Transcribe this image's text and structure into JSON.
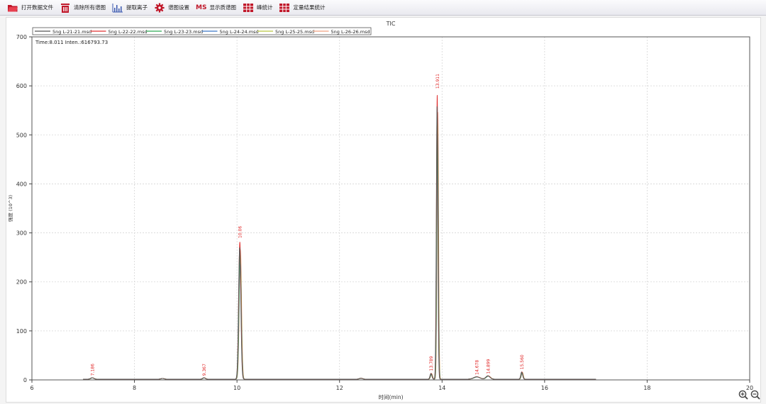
{
  "toolbar": {
    "items": [
      {
        "label": "打开数据文件",
        "icon": "open-file-icon"
      },
      {
        "label": "清除所有谱图",
        "icon": "trash-icon"
      },
      {
        "label": "提取离子",
        "icon": "spectrum-icon"
      },
      {
        "label": "谱图设置",
        "icon": "gear-icon"
      },
      {
        "label": "显示质谱图",
        "icon": "mass-spectrum-icon",
        "badge": "MS"
      },
      {
        "label": "峰统计",
        "icon": "table-icon"
      },
      {
        "label": "定量结果统计",
        "icon": "table-icon"
      }
    ]
  },
  "colors": {
    "accent": "#c0182a",
    "series": [
      "#555555",
      "#e03030",
      "#2eaa55",
      "#3a78c8",
      "#b9c840",
      "#f0a080"
    ]
  },
  "chart_data": {
    "type": "line",
    "title": "TIC",
    "xlabel": "时间(min)",
    "ylabel": "强度 (10^3)",
    "xlim": [
      6,
      20
    ],
    "ylim": [
      0,
      700
    ],
    "xticks": [
      6,
      8,
      10,
      12,
      14,
      16,
      18,
      20
    ],
    "yticks": [
      0,
      100,
      200,
      300,
      400,
      500,
      600,
      700
    ],
    "grid": true,
    "legend_position": "top",
    "readout": "Time:8.011  Inten.:616793.73",
    "x_range_plotted": [
      7.0,
      17.0
    ],
    "baseline": 1.5,
    "peaks": [
      {
        "x": 7.18,
        "height": 3,
        "width": 0.03
      },
      {
        "x": 8.55,
        "height": 1.5,
        "width": 0.03
      },
      {
        "x": 9.36,
        "height": 3,
        "width": 0.025
      },
      {
        "x": 10.06,
        "height": 280,
        "width": 0.022
      },
      {
        "x": 12.42,
        "height": 2,
        "width": 0.03
      },
      {
        "x": 13.79,
        "height": 12,
        "width": 0.018
      },
      {
        "x": 13.91,
        "height": 580,
        "width": 0.015
      },
      {
        "x": 14.68,
        "height": 5,
        "width": 0.06
      },
      {
        "x": 14.9,
        "height": 7,
        "width": 0.04
      },
      {
        "x": 15.56,
        "height": 15,
        "width": 0.018
      }
    ],
    "series": [
      {
        "name": "5ng L-21-21.msd",
        "scale": 0.96
      },
      {
        "name": "5ng L-22-22.msd",
        "scale": 1.0
      },
      {
        "name": "5ng L-23-23.msd",
        "scale": 0.92
      },
      {
        "name": "5ng L-24-24.msd",
        "scale": 0.88
      },
      {
        "name": "5ng L-25-25.msd",
        "scale": 0.9
      },
      {
        "name": "5ng L-26-26.msd",
        "scale": 0.94
      }
    ],
    "peak_labels": [
      {
        "x": 7.18,
        "y": 4,
        "text": "7.186"
      },
      {
        "x": 9.36,
        "y": 4,
        "text": "9.367"
      },
      {
        "x": 10.06,
        "y": 285,
        "text": "10.06"
      },
      {
        "x": 13.79,
        "y": 14,
        "text": "13.789"
      },
      {
        "x": 13.91,
        "y": 590,
        "text": "13.911"
      },
      {
        "x": 14.68,
        "y": 6,
        "text": "14.678"
      },
      {
        "x": 14.9,
        "y": 8,
        "text": "14.899"
      },
      {
        "x": 15.56,
        "y": 17,
        "text": "15.560"
      }
    ]
  }
}
